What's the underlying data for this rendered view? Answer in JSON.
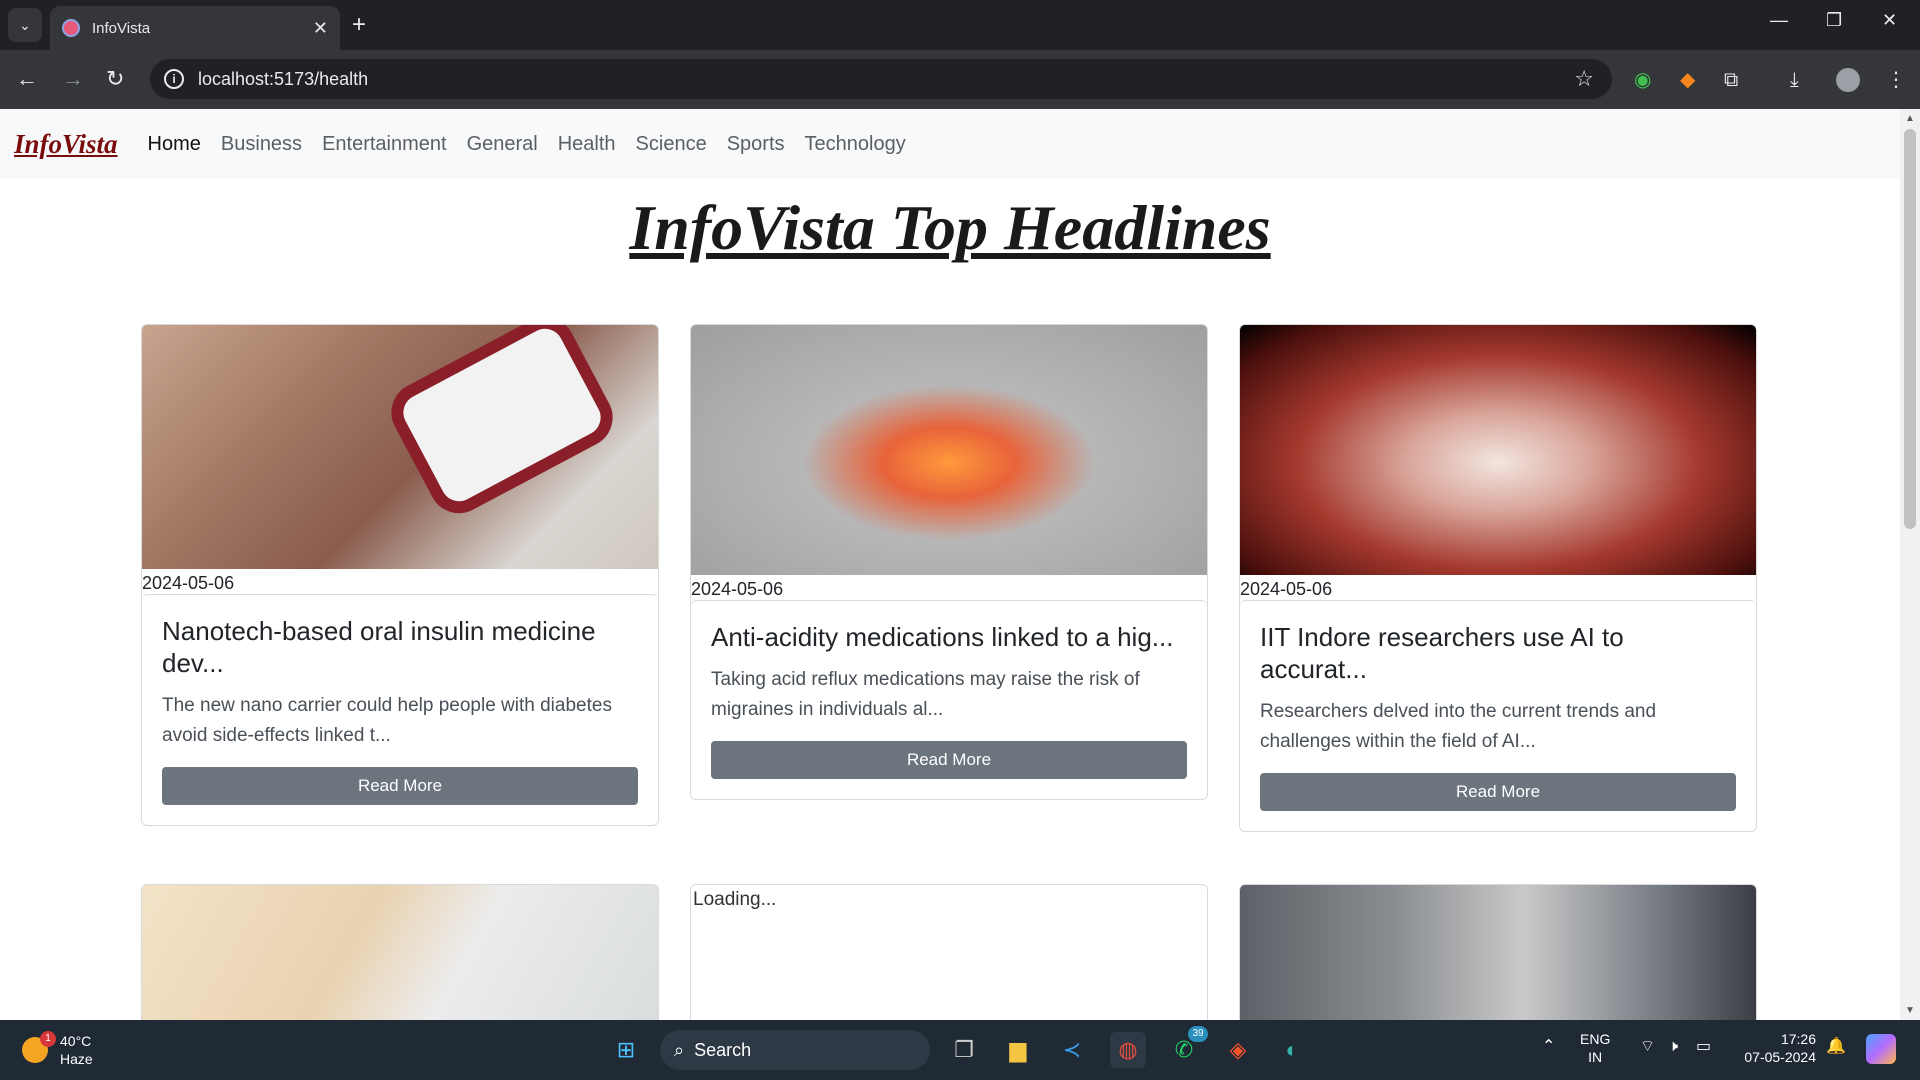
{
  "browser": {
    "tab_title": "InfoVista",
    "url": "localhost:5173/health"
  },
  "nav": {
    "brand": "InfoVista",
    "links": [
      "Home",
      "Business",
      "Entertainment",
      "General",
      "Health",
      "Science",
      "Sports",
      "Technology"
    ],
    "active": "Home"
  },
  "page": {
    "heading": "InfoVista Top Headlines"
  },
  "cards": [
    {
      "date": "2024-05-06",
      "title": "Nanotech-based oral insulin medicine dev...",
      "desc": "The new nano carrier could help people with diabetes avoid side-effects linked t...",
      "button": "Read More"
    },
    {
      "date": "2024-05-06",
      "title": "Anti-acidity medications linked to a hig...",
      "desc": "Taking acid reflux medications may raise the risk of migraines in individuals al...",
      "button": "Read More"
    },
    {
      "date": "2024-05-06",
      "title": "IIT Indore researchers use AI to accurat...",
      "desc": "Researchers delved into the current trends and challenges within the field of AI...",
      "button": "Read More"
    }
  ],
  "second_row": {
    "loading_alt": "Loading..."
  },
  "taskbar": {
    "temp": "40°C",
    "weather": "Haze",
    "weather_badge": "1",
    "search": "Search",
    "whatsapp_badge": "39",
    "lang1": "ENG",
    "lang2": "IN",
    "time": "17:26",
    "date": "07-05-2024"
  },
  "colors": {
    "brand": "#7a0c0c",
    "button": "#6c757d",
    "navbar_bg": "#f8f9fa"
  }
}
